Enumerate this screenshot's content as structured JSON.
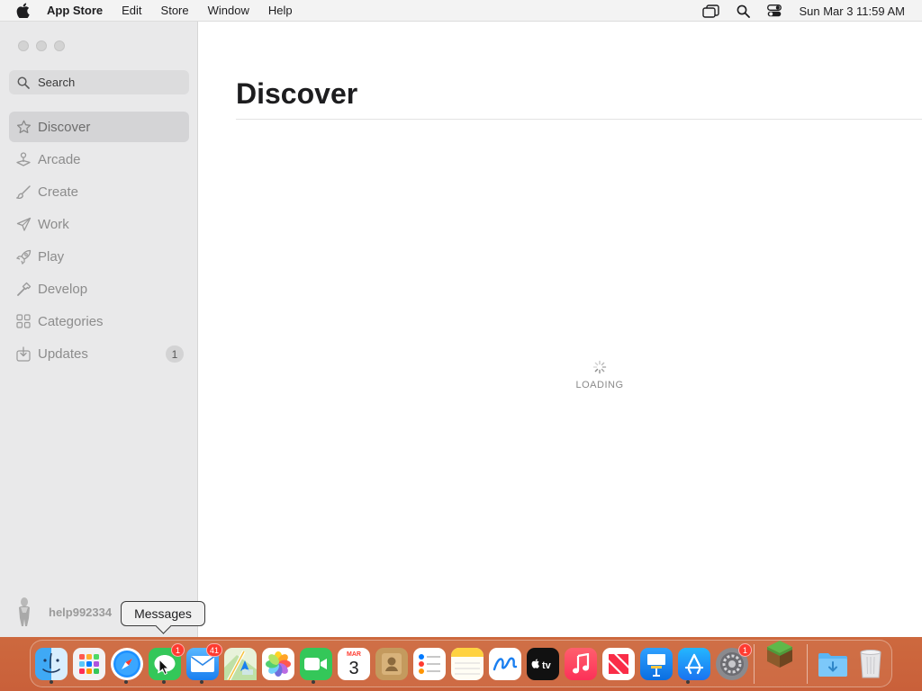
{
  "menubar": {
    "apple_icon": "apple-icon",
    "app_name": "App Store",
    "menus": [
      "Edit",
      "Store",
      "Window",
      "Help"
    ],
    "status_icons": [
      "screen-mirroring-icon",
      "spotlight-search-icon",
      "control-center-icon"
    ],
    "clock": "Sun Mar 3  11:59 AM"
  },
  "window": {
    "traffic_lights": [
      "close",
      "minimize",
      "zoom"
    ],
    "sidebar": {
      "search_placeholder": "Search",
      "items": [
        {
          "label": "Discover",
          "icon": "star-icon",
          "active": true
        },
        {
          "label": "Arcade",
          "icon": "joystick-icon"
        },
        {
          "label": "Create",
          "icon": "brush-icon"
        },
        {
          "label": "Work",
          "icon": "paper-plane-icon"
        },
        {
          "label": "Play",
          "icon": "rocket-icon"
        },
        {
          "label": "Develop",
          "icon": "hammer-icon"
        },
        {
          "label": "Categories",
          "icon": "grid-icon"
        },
        {
          "label": "Updates",
          "icon": "download-icon",
          "badge": "1"
        }
      ],
      "account_name": "help992334"
    },
    "main": {
      "title": "Discover",
      "loading_label": "LOADING"
    }
  },
  "tooltip": {
    "text": "Messages"
  },
  "dock": {
    "apps": [
      {
        "name": "Finder",
        "icon": "finder-icon",
        "running": true
      },
      {
        "name": "Launchpad",
        "icon": "launchpad-icon"
      },
      {
        "name": "Safari",
        "icon": "safari-icon",
        "running": true
      },
      {
        "name": "Messages",
        "icon": "messages-icon",
        "badge": "1",
        "running": true
      },
      {
        "name": "Mail",
        "icon": "mail-icon",
        "badge": "41",
        "running": true
      },
      {
        "name": "Maps",
        "icon": "maps-icon"
      },
      {
        "name": "Photos",
        "icon": "photos-icon"
      },
      {
        "name": "FaceTime",
        "icon": "facetime-icon",
        "running": true
      },
      {
        "name": "Calendar",
        "icon": "calendar-icon",
        "month": "MAR",
        "day": "3"
      },
      {
        "name": "Contacts",
        "icon": "contacts-icon"
      },
      {
        "name": "Reminders",
        "icon": "reminders-icon"
      },
      {
        "name": "Notes",
        "icon": "notes-icon"
      },
      {
        "name": "Freeform",
        "icon": "freeform-icon"
      },
      {
        "name": "TV",
        "icon": "apple-tv-icon",
        "label": "tv"
      },
      {
        "name": "Music",
        "icon": "music-icon"
      },
      {
        "name": "News",
        "icon": "news-icon"
      },
      {
        "name": "Keynote",
        "icon": "keynote-icon"
      },
      {
        "name": "App Store",
        "icon": "app-store-icon",
        "running": true
      },
      {
        "name": "System Settings",
        "icon": "system-settings-icon",
        "badge": "1"
      },
      {
        "name": "Minecraft",
        "icon": "minecraft-icon"
      },
      {
        "name": "Downloads",
        "icon": "downloads-folder-icon"
      },
      {
        "name": "Trash",
        "icon": "trash-icon"
      }
    ]
  },
  "colors": {
    "sidebar_bg": "#e9e9ea",
    "active_item_bg": "#d4d4d6",
    "badge_red": "#ff3b30",
    "app_store_blue": "#1a8cff"
  }
}
